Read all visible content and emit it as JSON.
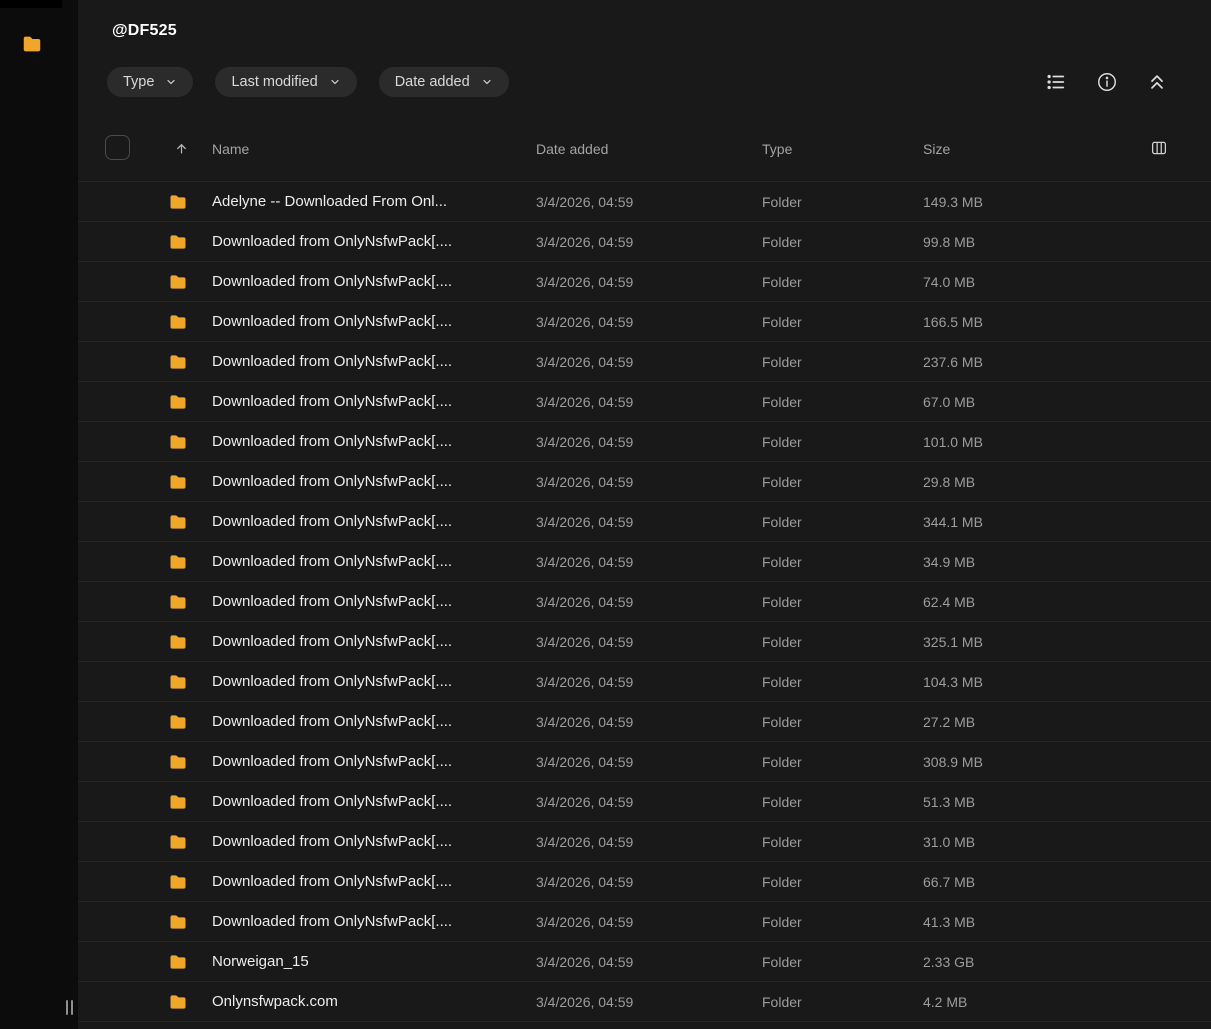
{
  "header": {
    "title": "@DF525"
  },
  "filters": {
    "type": "Type",
    "last_modified": "Last modified",
    "date_added": "Date added"
  },
  "icons": {
    "sidebar_folder": "folder-icon",
    "filter_chevron": "chevron-down-icon",
    "list_view": "list-view-icon",
    "info": "info-icon",
    "collapse": "chevrons-up-icon",
    "sort_ascending": "arrow-up-icon",
    "column_settings": "columns-icon",
    "row_folder": "folder-icon"
  },
  "colors": {
    "background": "#191919",
    "sidebar": "#0C0C0C",
    "folder": "#EFA62B",
    "chip_background": "#2B2B2B",
    "divider": "#262626"
  },
  "table": {
    "headers": {
      "name": "Name",
      "date_added": "Date added",
      "type": "Type",
      "size": "Size"
    },
    "rows": [
      {
        "name": "Adelyne -- Downloaded From Onl...",
        "date_added": "3/4/2026, 04:59",
        "type": "Folder",
        "size": "149.3 MB"
      },
      {
        "name": "Downloaded from OnlyNsfwPack[....",
        "date_added": "3/4/2026, 04:59",
        "type": "Folder",
        "size": "99.8 MB"
      },
      {
        "name": "Downloaded from OnlyNsfwPack[....",
        "date_added": "3/4/2026, 04:59",
        "type": "Folder",
        "size": "74.0 MB"
      },
      {
        "name": "Downloaded from OnlyNsfwPack[....",
        "date_added": "3/4/2026, 04:59",
        "type": "Folder",
        "size": "166.5 MB"
      },
      {
        "name": "Downloaded from OnlyNsfwPack[....",
        "date_added": "3/4/2026, 04:59",
        "type": "Folder",
        "size": "237.6 MB"
      },
      {
        "name": "Downloaded from OnlyNsfwPack[....",
        "date_added": "3/4/2026, 04:59",
        "type": "Folder",
        "size": "67.0 MB"
      },
      {
        "name": "Downloaded from OnlyNsfwPack[....",
        "date_added": "3/4/2026, 04:59",
        "type": "Folder",
        "size": "101.0 MB"
      },
      {
        "name": "Downloaded from OnlyNsfwPack[....",
        "date_added": "3/4/2026, 04:59",
        "type": "Folder",
        "size": "29.8 MB"
      },
      {
        "name": "Downloaded from OnlyNsfwPack[....",
        "date_added": "3/4/2026, 04:59",
        "type": "Folder",
        "size": "344.1 MB"
      },
      {
        "name": "Downloaded from OnlyNsfwPack[....",
        "date_added": "3/4/2026, 04:59",
        "type": "Folder",
        "size": "34.9 MB"
      },
      {
        "name": "Downloaded from OnlyNsfwPack[....",
        "date_added": "3/4/2026, 04:59",
        "type": "Folder",
        "size": "62.4 MB"
      },
      {
        "name": "Downloaded from OnlyNsfwPack[....",
        "date_added": "3/4/2026, 04:59",
        "type": "Folder",
        "size": "325.1 MB"
      },
      {
        "name": "Downloaded from OnlyNsfwPack[....",
        "date_added": "3/4/2026, 04:59",
        "type": "Folder",
        "size": "104.3 MB"
      },
      {
        "name": "Downloaded from OnlyNsfwPack[....",
        "date_added": "3/4/2026, 04:59",
        "type": "Folder",
        "size": "27.2 MB"
      },
      {
        "name": "Downloaded from OnlyNsfwPack[....",
        "date_added": "3/4/2026, 04:59",
        "type": "Folder",
        "size": "308.9 MB"
      },
      {
        "name": "Downloaded from OnlyNsfwPack[....",
        "date_added": "3/4/2026, 04:59",
        "type": "Folder",
        "size": "51.3 MB"
      },
      {
        "name": "Downloaded from OnlyNsfwPack[....",
        "date_added": "3/4/2026, 04:59",
        "type": "Folder",
        "size": "31.0 MB"
      },
      {
        "name": "Downloaded from OnlyNsfwPack[....",
        "date_added": "3/4/2026, 04:59",
        "type": "Folder",
        "size": "66.7 MB"
      },
      {
        "name": "Downloaded from OnlyNsfwPack[....",
        "date_added": "3/4/2026, 04:59",
        "type": "Folder",
        "size": "41.3 MB"
      },
      {
        "name": "Norweigan_15",
        "date_added": "3/4/2026, 04:59",
        "type": "Folder",
        "size": "2.33 GB"
      },
      {
        "name": "Onlynsfwpack.com",
        "date_added": "3/4/2026, 04:59",
        "type": "Folder",
        "size": "4.2 MB"
      }
    ]
  }
}
